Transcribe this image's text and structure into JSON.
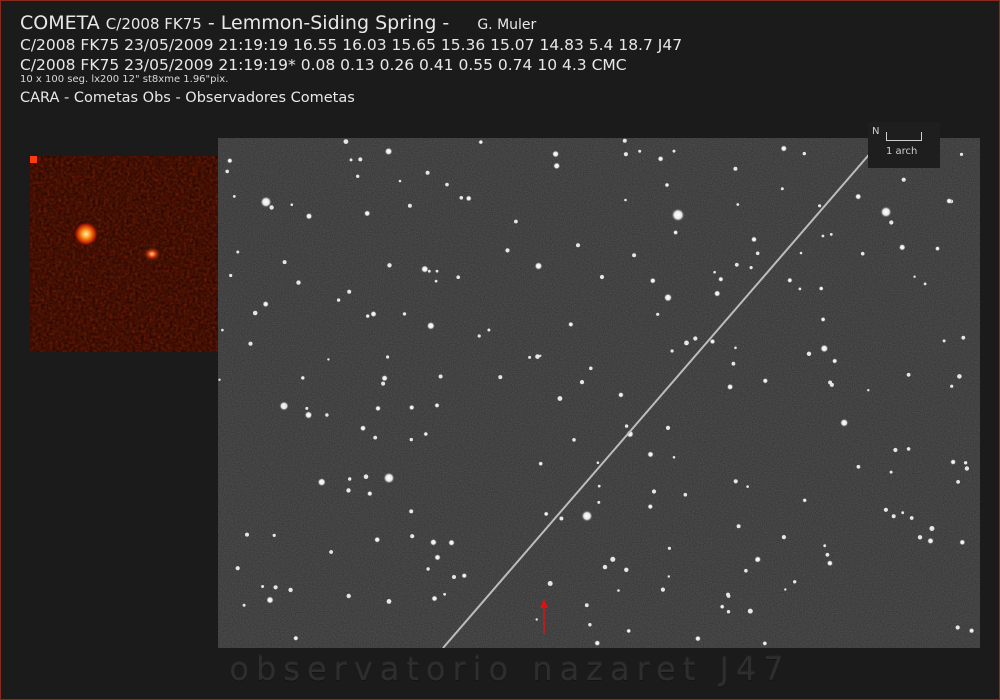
{
  "header": {
    "title_main": "COMETA",
    "title_designation": "C/2008 FK75",
    "title_name": "- Lemmon-Siding Spring -",
    "author": "G. Muler",
    "line2": "C/2008 FK75 23/05/2009 21:19:19 16.55 16.03 15.65 15.36 15.07 14.83 5.4 18.7 J47",
    "line3": "C/2008 FK75 23/05/2009 21:19:19* 0.08 0.13 0.26 0.41 0.55 0.74 10 4.3 CMC",
    "line4": "10 x 100 seg. lx200 12\" st8xme 1.96\"pix.",
    "line5": "CARA - Cometas Obs - Observadores Cometas"
  },
  "scale": {
    "north_label": "N",
    "unit_label": "1 arch"
  },
  "watermark": "observatorio nazaret J47",
  "colors": {
    "frame_border": "#8a2a1e",
    "comet_marker": "#e01010",
    "inset_hot": "#ff7a10"
  },
  "icons": {
    "comet_marker": "red-arrow-up-icon",
    "north_indicator": "north-arrow-icon"
  }
}
